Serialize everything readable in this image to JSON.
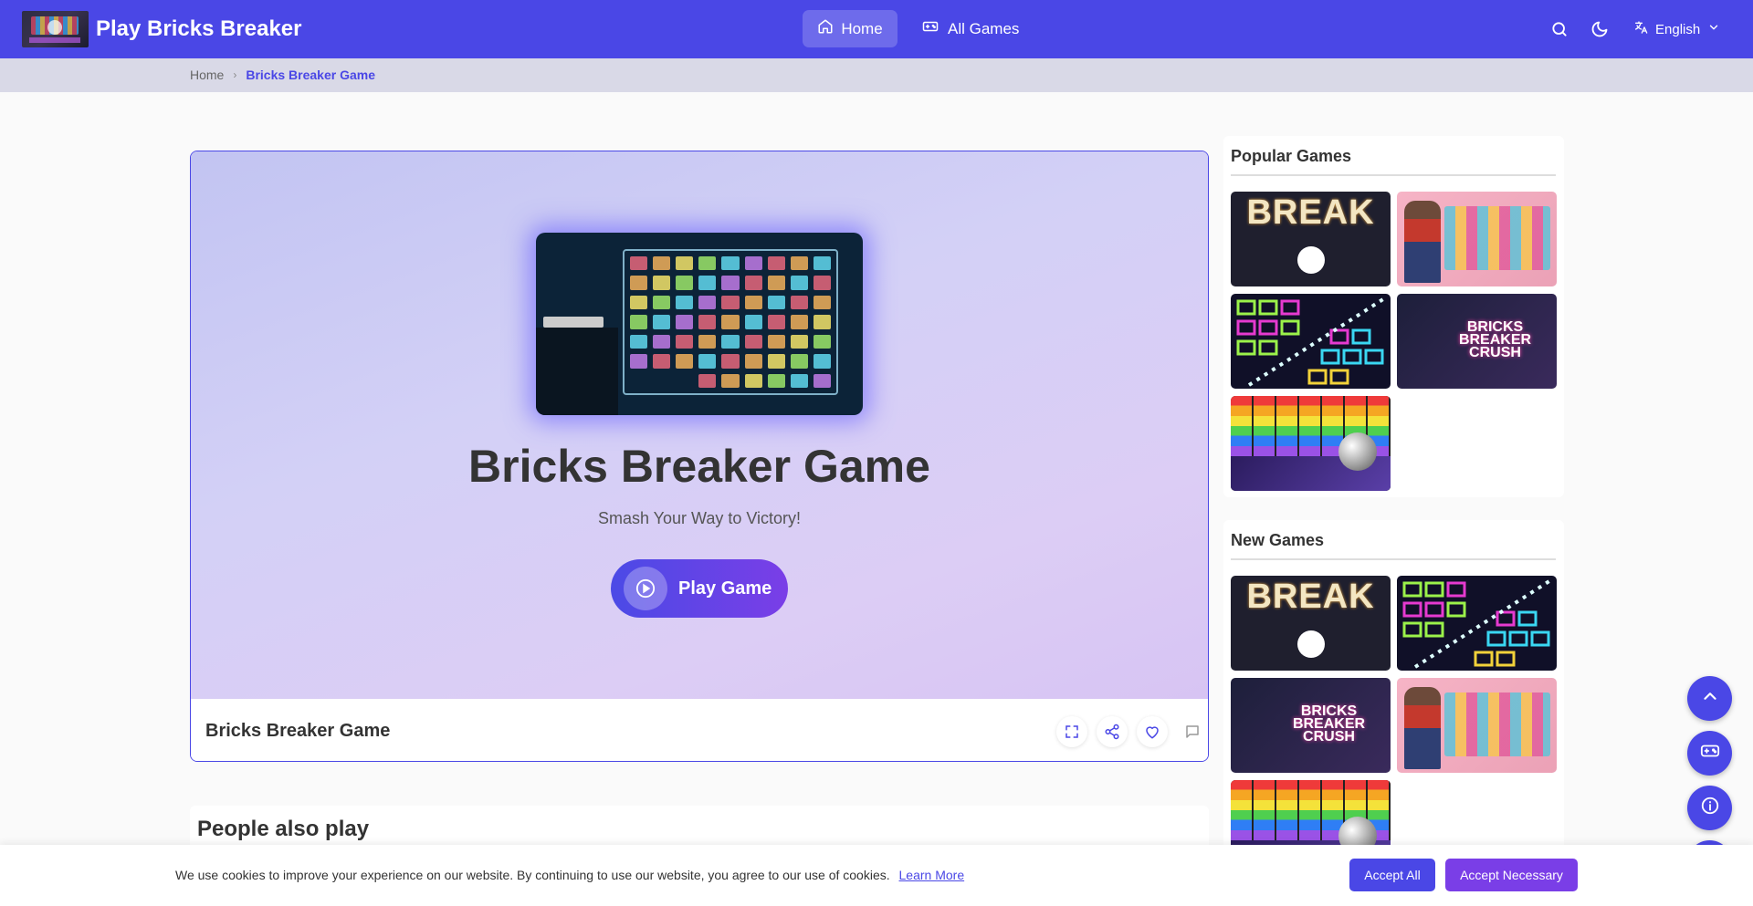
{
  "header": {
    "site_title": "Play Bricks Breaker",
    "nav_home": "Home",
    "nav_all_games": "All Games",
    "language": "English"
  },
  "breadcrumb": {
    "home": "Home",
    "current": "Bricks Breaker Game"
  },
  "game": {
    "title": "Bricks Breaker Game",
    "subtitle": "Smash Your Way to Victory!",
    "play_label": "Play Game",
    "footer_title": "Bricks Breaker Game"
  },
  "people_also_play": {
    "title": "People also play"
  },
  "sidebar": {
    "popular_title": "Popular Games",
    "new_title": "New Games",
    "break_tile_text": "BREAK",
    "crush_tile_text": "BRICKS BREAKER CRUSH"
  },
  "cookie": {
    "text": "We use cookies to improve your experience on our website. By continuing to use our website, you agree to our use of cookies.",
    "learn_more": "Learn More",
    "accept_all": "Accept All",
    "accept_necessary": "Accept Necessary"
  },
  "colors": {
    "brand": "#4a47e6",
    "accent_purple": "#7a3ee7"
  }
}
